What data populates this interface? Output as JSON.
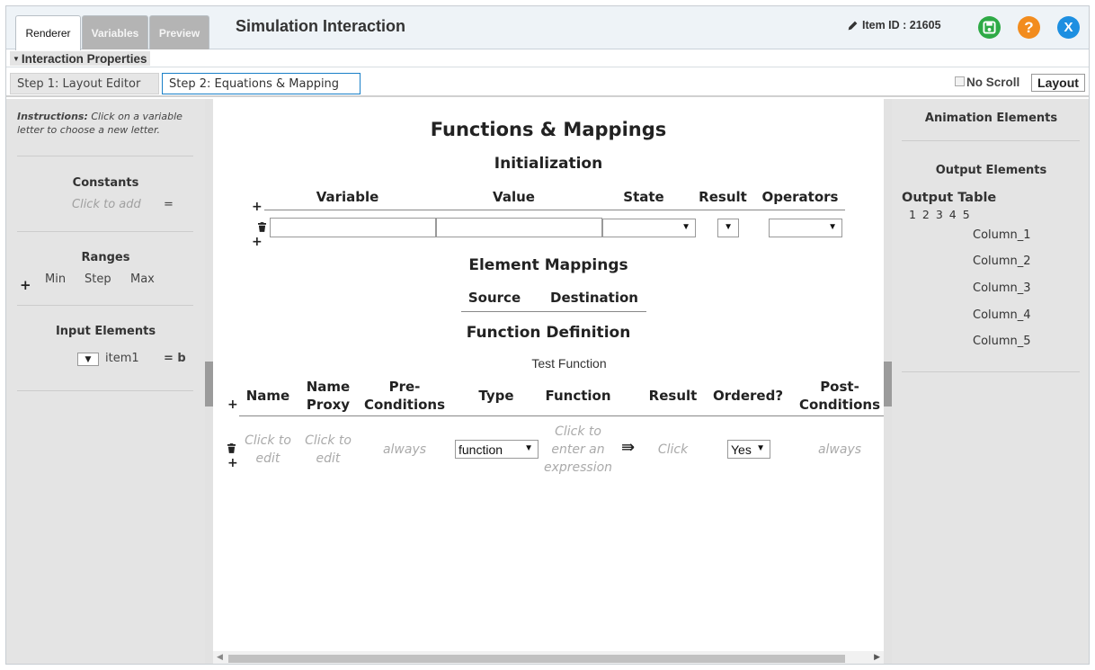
{
  "header": {
    "tabs": [
      "Renderer",
      "Variables",
      "Preview"
    ],
    "title": "Simulation Interaction",
    "item_id": "Item ID : 21605",
    "buttons": {
      "save_icon": "save-icon",
      "help_label": "?",
      "close_label": "X"
    },
    "colors": {
      "save": "#2eaa46",
      "help": "#f28c1e",
      "close": "#1d8fe1"
    }
  },
  "interaction_properties": {
    "label": "Interaction Properties"
  },
  "steps": {
    "step1": "Step 1: Layout Editor",
    "step2": "Step 2: Equations & Mapping",
    "no_scroll": "No Scroll",
    "layout": "Layout"
  },
  "left_panel": {
    "instructions_bold": "Instructions:",
    "instructions_text": "Click on a variable letter to choose a new letter.",
    "constants": {
      "title": "Constants",
      "placeholder": "Click to add",
      "equals": "="
    },
    "ranges": {
      "title": "Ranges",
      "plus": "+",
      "min": "Min",
      "step": "Step",
      "max": "Max"
    },
    "input_elements": {
      "title": "Input Elements",
      "select_arrow": "▼",
      "item": "item1",
      "assignment": "= b"
    }
  },
  "center": {
    "title": "Functions & Mappings",
    "initialization": {
      "title": "Initialization",
      "plus": "+",
      "columns": [
        "Variable",
        "Value",
        "State",
        "Result",
        "Operators"
      ]
    },
    "element_mappings": {
      "title": "Element Mappings",
      "columns": [
        "Source",
        "Destination"
      ]
    },
    "function_definition": {
      "title": "Function Definition",
      "test_function": "Test Function",
      "columns": {
        "name": "Name",
        "name_proxy_1": "Name",
        "name_proxy_2": "Proxy",
        "pre_1": "Pre-",
        "pre_2": "Conditions",
        "type": "Type",
        "function": "Function",
        "result": "Result",
        "ordered": "Ordered?",
        "post_1": "Post-",
        "post_2": "Conditions"
      },
      "row": {
        "name_1": "Click to",
        "name_2": "edit",
        "proxy_1": "Click to",
        "proxy_2": "edit",
        "pre": "always",
        "type_value": "function",
        "fn_1": "Click to",
        "fn_2": "enter an",
        "fn_3": "expression",
        "arrow": "⇛",
        "result": "Click",
        "ordered_value": "Yes",
        "post": "always"
      }
    }
  },
  "right_panel": {
    "animation_elements": "Animation Elements",
    "output_elements": "Output Elements",
    "output_table": {
      "title": "Output Table",
      "numbers": "1 2 3 4 5",
      "columns": [
        "Column_1",
        "Column_2",
        "Column_3",
        "Column_4",
        "Column_5"
      ]
    }
  }
}
